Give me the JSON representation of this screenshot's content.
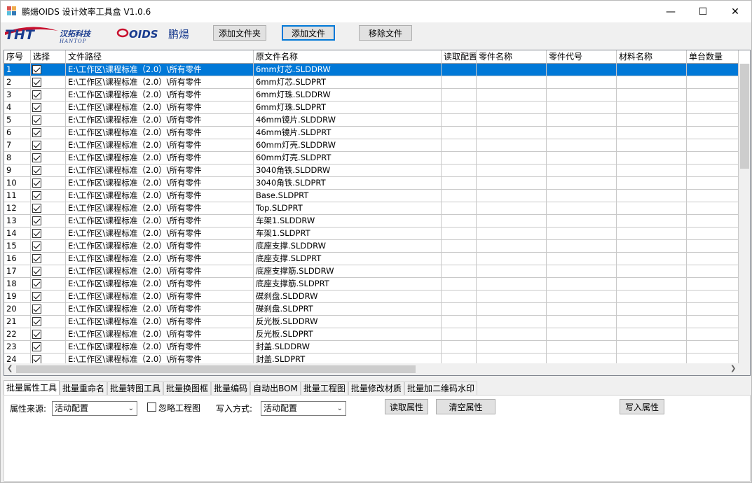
{
  "window": {
    "title": "鹏煬OIDS 设计效率工具盒 V1.0.6",
    "minimize": "—",
    "maximize": "☐",
    "close": "✕"
  },
  "logo": {
    "tht": "THT",
    "cn": "汉拓科技",
    "en": "HANTOP",
    "oids": "OIDS",
    "brand": "鹏煬"
  },
  "toolbar": {
    "add_folder": "添加文件夹",
    "add_file": "添加文件",
    "remove_file": "移除文件"
  },
  "table": {
    "columns": [
      "序号",
      "选择",
      "文件路径",
      "原文件名称",
      "读取配置",
      "零件名称",
      "零件代号",
      "材料名称",
      "单台数量"
    ],
    "rows": [
      {
        "no": "1",
        "path": "E:\\工作区\\课程标准（2.0）\\所有零件",
        "name": "6mm灯芯.SLDDRW"
      },
      {
        "no": "2",
        "path": "E:\\工作区\\课程标准（2.0）\\所有零件",
        "name": "6mm灯芯.SLDPRT"
      },
      {
        "no": "3",
        "path": "E:\\工作区\\课程标准（2.0）\\所有零件",
        "name": "6mm灯珠.SLDDRW"
      },
      {
        "no": "4",
        "path": "E:\\工作区\\课程标准（2.0）\\所有零件",
        "name": "6mm灯珠.SLDPRT"
      },
      {
        "no": "5",
        "path": "E:\\工作区\\课程标准（2.0）\\所有零件",
        "name": "46mm镜片.SLDDRW"
      },
      {
        "no": "6",
        "path": "E:\\工作区\\课程标准（2.0）\\所有零件",
        "name": "46mm镜片.SLDPRT"
      },
      {
        "no": "7",
        "path": "E:\\工作区\\课程标准（2.0）\\所有零件",
        "name": "60mm灯壳.SLDDRW"
      },
      {
        "no": "8",
        "path": "E:\\工作区\\课程标准（2.0）\\所有零件",
        "name": "60mm灯壳.SLDPRT"
      },
      {
        "no": "9",
        "path": "E:\\工作区\\课程标准（2.0）\\所有零件",
        "name": "3040角铁.SLDDRW"
      },
      {
        "no": "10",
        "path": "E:\\工作区\\课程标准（2.0）\\所有零件",
        "name": "3040角铁.SLDPRT"
      },
      {
        "no": "11",
        "path": "E:\\工作区\\课程标准（2.0）\\所有零件",
        "name": "Base.SLDPRT"
      },
      {
        "no": "12",
        "path": "E:\\工作区\\课程标准（2.0）\\所有零件",
        "name": "Top.SLDPRT"
      },
      {
        "no": "13",
        "path": "E:\\工作区\\课程标准（2.0）\\所有零件",
        "name": "车架1.SLDDRW"
      },
      {
        "no": "14",
        "path": "E:\\工作区\\课程标准（2.0）\\所有零件",
        "name": "车架1.SLDPRT"
      },
      {
        "no": "15",
        "path": "E:\\工作区\\课程标准（2.0）\\所有零件",
        "name": "底座支撑.SLDDRW"
      },
      {
        "no": "16",
        "path": "E:\\工作区\\课程标准（2.0）\\所有零件",
        "name": "底座支撑.SLDPRT"
      },
      {
        "no": "17",
        "path": "E:\\工作区\\课程标准（2.0）\\所有零件",
        "name": "底座支撑筋.SLDDRW"
      },
      {
        "no": "18",
        "path": "E:\\工作区\\课程标准（2.0）\\所有零件",
        "name": "底座支撑筋.SLDPRT"
      },
      {
        "no": "19",
        "path": "E:\\工作区\\课程标准（2.0）\\所有零件",
        "name": "碟刹盘.SLDDRW"
      },
      {
        "no": "20",
        "path": "E:\\工作区\\课程标准（2.0）\\所有零件",
        "name": "碟刹盘.SLDPRT"
      },
      {
        "no": "21",
        "path": "E:\\工作区\\课程标准（2.0）\\所有零件",
        "name": "反光板.SLDDRW"
      },
      {
        "no": "22",
        "path": "E:\\工作区\\课程标准（2.0）\\所有零件",
        "name": "反光板.SLDPRT"
      },
      {
        "no": "23",
        "path": "E:\\工作区\\课程标准（2.0）\\所有零件",
        "name": "封盖.SLDDRW"
      },
      {
        "no": "24",
        "path": "E:\\工作区\\课程标准（2.0）\\所有零件",
        "name": "封盖.SLDPRT"
      }
    ],
    "selected_row": "1"
  },
  "tabs": [
    "批量属性工具",
    "批量重命名",
    "批量转图工具",
    "批量换图框",
    "批量编码",
    "自动出BOM",
    "批量工程图",
    "批量修改材质",
    "批量加二维码水印"
  ],
  "active_tab": "批量属性工具",
  "panel": {
    "source_label": "属性来源:",
    "source_value": "活动配置",
    "ignore_drawing": "忽略工程图",
    "write_mode_label": "写入方式:",
    "write_mode_value": "活动配置",
    "read_props": "读取属性",
    "clear_props": "清空属性",
    "write_props": "写入属性"
  },
  "colors": {
    "selection": "#0078d7",
    "logo_red": "#c8102e",
    "logo_blue": "#1a3c8f"
  }
}
